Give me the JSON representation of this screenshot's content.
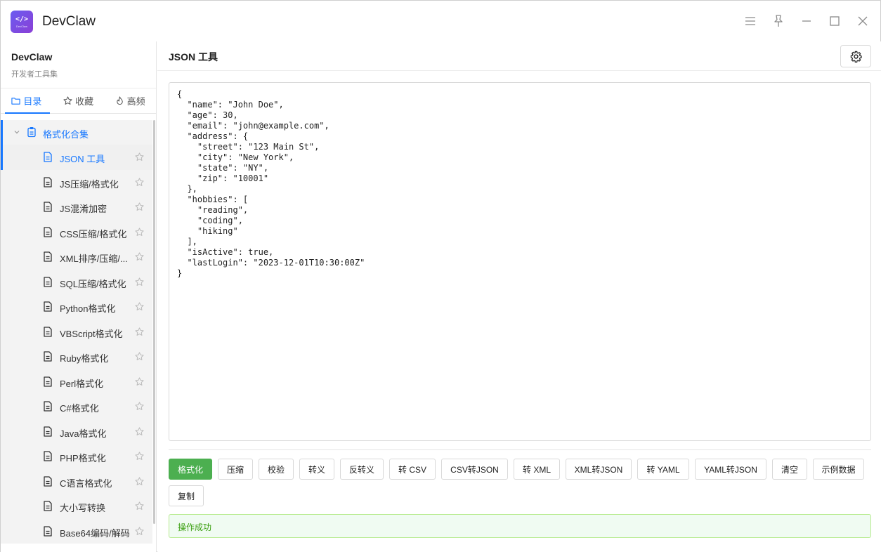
{
  "window": {
    "title": "DevClaw",
    "logo_text": "</>",
    "logo_subtext": "DevClaw"
  },
  "sidebar": {
    "brand": "DevClaw",
    "subtitle": "开发者工具集",
    "tabs": [
      {
        "label": "目录",
        "icon": "folder-icon",
        "active": true
      },
      {
        "label": "收藏",
        "icon": "star-icon",
        "active": false
      },
      {
        "label": "高频",
        "icon": "flame-icon",
        "active": false
      }
    ],
    "group": {
      "label": "格式化合集",
      "icon": "clipboard-icon",
      "expanded": true
    },
    "items": [
      {
        "label": "JSON 工具",
        "active": true
      },
      {
        "label": "JS压缩/格式化"
      },
      {
        "label": "JS混淆加密"
      },
      {
        "label": "CSS压缩/格式化"
      },
      {
        "label": "XML排序/压缩/..."
      },
      {
        "label": "SQL压缩/格式化"
      },
      {
        "label": "Python格式化"
      },
      {
        "label": "VBScript格式化"
      },
      {
        "label": "Ruby格式化"
      },
      {
        "label": "Perl格式化"
      },
      {
        "label": "C#格式化"
      },
      {
        "label": "Java格式化"
      },
      {
        "label": "PHP格式化"
      },
      {
        "label": "C语言格式化"
      },
      {
        "label": "大小写转换"
      },
      {
        "label": "Base64编码/解码"
      }
    ]
  },
  "main": {
    "title": "JSON 工具",
    "settings_icon": "gear-icon",
    "editor_content": "{\n  \"name\": \"John Doe\",\n  \"age\": 30,\n  \"email\": \"john@example.com\",\n  \"address\": {\n    \"street\": \"123 Main St\",\n    \"city\": \"New York\",\n    \"state\": \"NY\",\n    \"zip\": \"10001\"\n  },\n  \"hobbies\": [\n    \"reading\",\n    \"coding\",\n    \"hiking\"\n  ],\n  \"isActive\": true,\n  \"lastLogin\": \"2023-12-01T10:30:00Z\"\n}",
    "buttons": [
      "格式化",
      "压缩",
      "校验",
      "转义",
      "反转义",
      "转 CSV",
      "CSV转JSON",
      "转 XML",
      "XML转JSON",
      "转 YAML",
      "YAML转JSON",
      "清空",
      "示例数据",
      "复制"
    ],
    "status_message": "操作成功"
  },
  "colors": {
    "accent": "#1677ff",
    "primary_button": "#4caf50",
    "success_text": "#389e0d",
    "success_bg": "#f0fbf2"
  }
}
